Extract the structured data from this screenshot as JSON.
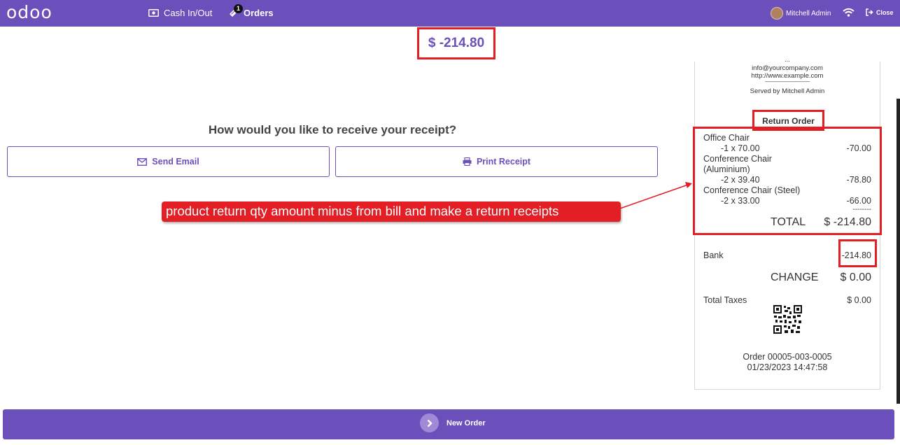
{
  "app": {
    "logo": "odoo"
  },
  "topbar": {
    "cash_label": "Cash In/Out",
    "orders_label": "Orders",
    "orders_badge": "1",
    "user_name": "Mitchell Admin",
    "close_label": "Close"
  },
  "payment": {
    "total_amount": "$ -214.80",
    "question": "How would you like to receive your receipt?",
    "send_email_label": "Send Email",
    "print_receipt_label": "Print Receipt"
  },
  "annotation": {
    "callout_text": "product return qty amount  minus  from bill and make  a  return receipts"
  },
  "receipt": {
    "header_line_partial": "...",
    "email": "info@yourcompany.com",
    "website": "http://www.example.com",
    "separator": "-----------------------------------",
    "served_by": "Served by Mitchell Admin",
    "title": "Return Order",
    "lines": [
      {
        "name": "Office Chair",
        "name_cont": "",
        "qty_price": "-1 x 70.00",
        "amount": "-70.00"
      },
      {
        "name": "Conference Chair",
        "name_cont": "(Aluminium)",
        "qty_price": "-2 x 39.40",
        "amount": "-78.80"
      },
      {
        "name": "Conference Chair (Steel)",
        "name_cont": "",
        "qty_price": "-2 x 33.00",
        "amount": "-66.00"
      }
    ],
    "dashes": "--------",
    "total_label": "TOTAL",
    "total_value": "$ -214.80",
    "payment_method": "Bank",
    "payment_amount": "-214.80",
    "change_label": "CHANGE",
    "change_value": "$ 0.00",
    "taxes_label": "Total Taxes",
    "taxes_value": "$ 0.00",
    "order_ref": "Order 00005-003-0005",
    "order_date": "01/23/2023 14:47:58"
  },
  "footer": {
    "new_order_label": "New Order"
  },
  "colors": {
    "brand": "#6b4fbb",
    "annotation_red": "#e31e24"
  }
}
